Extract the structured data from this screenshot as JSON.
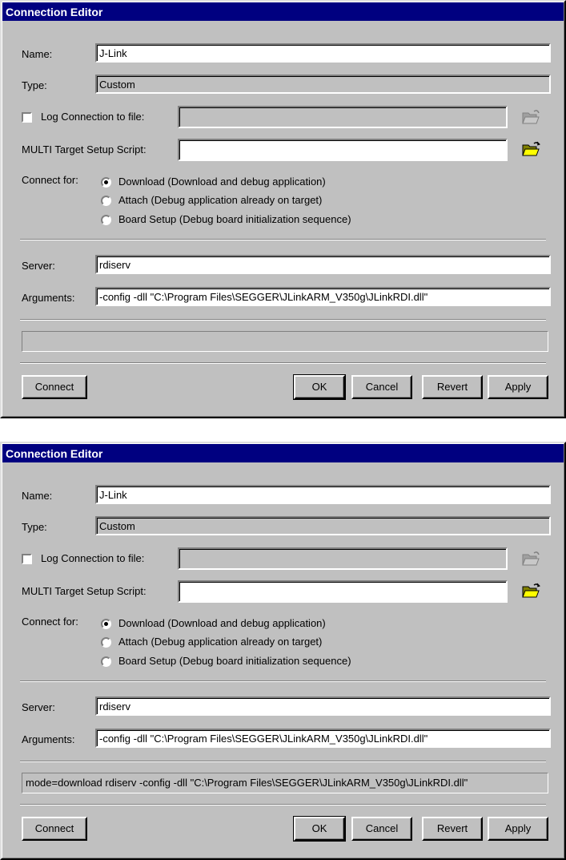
{
  "dialogs": [
    {
      "title": "Connection Editor",
      "name_label": "Name:",
      "name_value": "J-Link",
      "type_label": "Type:",
      "type_value": "Custom",
      "log_label": "Log Connection to file:",
      "log_value": "",
      "script_label": "MULTI Target Setup Script:",
      "script_value": "",
      "connect_for_label": "Connect for:",
      "radio_download": "Download (Download and debug application)",
      "radio_attach": "Attach (Debug application already on target)",
      "radio_board": "Board Setup (Debug board initialization sequence)",
      "server_label": "Server:",
      "server_value": "rdiserv",
      "arguments_label": "Arguments:",
      "arguments_value": "-config -dll \"C:\\Program Files\\SEGGER\\JLinkARM_V350g\\JLinkRDI.dll\"",
      "status_text": "",
      "connect_button": "Connect",
      "ok_button": "OK",
      "cancel_button": "Cancel",
      "revert_button": "Revert",
      "apply_button": "Apply"
    },
    {
      "title": "Connection Editor",
      "name_label": "Name:",
      "name_value": "J-Link",
      "type_label": "Type:",
      "type_value": "Custom",
      "log_label": "Log Connection to file:",
      "log_value": "",
      "script_label": "MULTI Target Setup Script:",
      "script_value": "",
      "connect_for_label": "Connect for:",
      "radio_download": "Download (Download and debug application)",
      "radio_attach": "Attach (Debug application already on target)",
      "radio_board": "Board Setup (Debug board initialization sequence)",
      "server_label": "Server:",
      "server_value": "rdiserv",
      "arguments_label": "Arguments:",
      "arguments_value": "-config -dll \"C:\\Program Files\\SEGGER\\JLinkARM_V350g\\JLinkRDI.dll\"",
      "status_text": "mode=download rdiserv -config -dll \"C:\\Program Files\\SEGGER\\JLinkARM_V350g\\JLinkRDI.dll\"",
      "connect_button": "Connect",
      "ok_button": "OK",
      "cancel_button": "Cancel",
      "revert_button": "Revert",
      "apply_button": "Apply"
    }
  ],
  "icons": {
    "browse_disabled": "folder-open-icon",
    "browse": "folder-open-icon"
  },
  "colors": {
    "titlebar": "#000080",
    "face": "#c0c0c0",
    "folder": "#ffff00"
  }
}
